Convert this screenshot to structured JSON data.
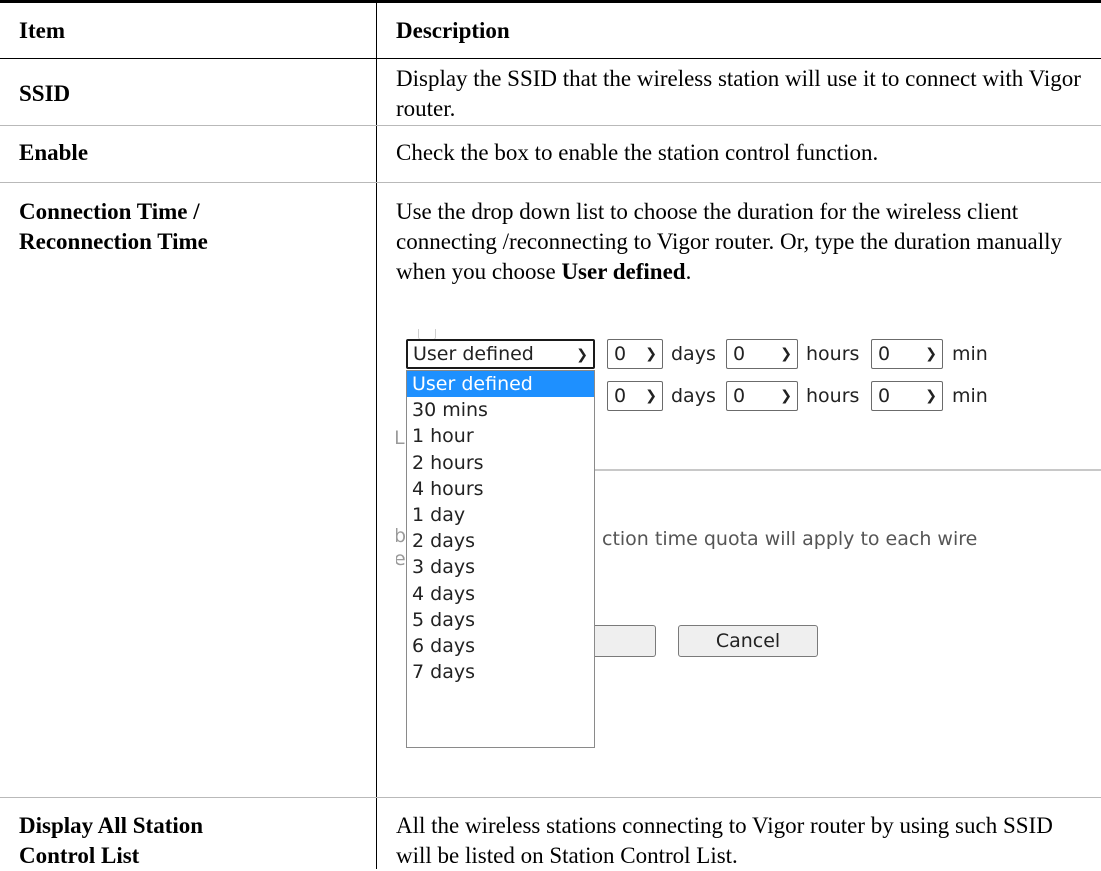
{
  "table": {
    "headers": {
      "item": "Item",
      "description": "Description"
    },
    "rows": [
      {
        "item": "SSID",
        "description": "Display the SSID that the wireless station will use it to connect with Vigor router."
      },
      {
        "item": "Enable",
        "description": "Check the box to enable the station control function."
      },
      {
        "item_line1": "Connection Time /",
        "item_line2": "Reconnection Time",
        "description_pre": "Use the drop down list to choose the duration for the wireless client connecting /reconnecting to Vigor router. Or, type the duration manually when you choose ",
        "description_bold": "User defined",
        "description_post": "."
      },
      {
        "item_line1": "Display All Station",
        "item_line2": "Control List",
        "description": "All the wireless stations connecting to Vigor router by using such SSID will be listed on Station Control List."
      }
    ]
  },
  "screenshot": {
    "row1": {
      "mode": "User defined",
      "days_value": "0",
      "days_label": "days",
      "hours_value": "0",
      "hours_label": "hours",
      "min_value": "0",
      "min_label": "min"
    },
    "row2": {
      "days_value": "0",
      "days_label": "days",
      "hours_value": "0",
      "hours_label": "hours",
      "min_value": "0",
      "min_label": "min"
    },
    "partial_link": "Li",
    "partial_b": "b",
    "partial_e": "e",
    "partial_text": "ction time quota will apply to each wire",
    "cancel_label": "Cancel",
    "dropdown_options": [
      "User defined",
      "30 mins",
      "1 hour",
      "2 hours",
      "4 hours",
      "1 day",
      "2 days",
      "3 days",
      "4 days",
      "5 days",
      "6 days",
      "7 days"
    ],
    "selected_option": "User defined",
    "chevron_icon": "chevron-down-icon"
  }
}
